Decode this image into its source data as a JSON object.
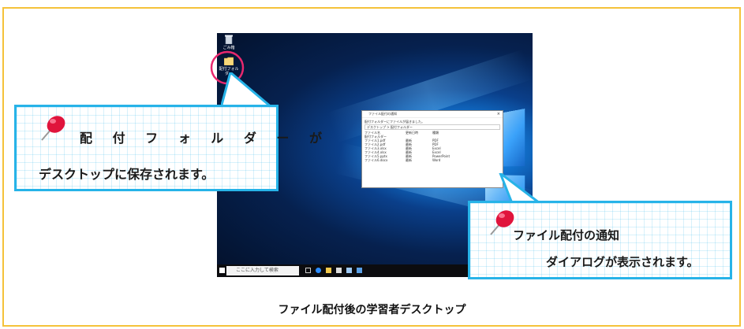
{
  "callout_left": {
    "line1": "配 付 フ ォ ル ダ ー が",
    "line2": "デスクトップに保存されます。"
  },
  "callout_right": {
    "line1": "ファイル配付の通知",
    "line2": "ダイアログが表示されます。"
  },
  "caption": "ファイル配付後の学習者デスクトップ",
  "desktop": {
    "recycle_bin_label": "ごみ箱",
    "folder_label": "配付フォルダー",
    "taskbar_search_placeholder": "ここに入力して検索"
  },
  "dialog": {
    "title": "ファイル配付の通知",
    "message": "配付フォルダーにファイルが届きました。",
    "path": "デスクトップ > 配付フォルダー",
    "columns": [
      "ファイル名",
      "更新日時",
      "種類"
    ],
    "folder_row": "配付フォルダー",
    "files": [
      {
        "name": "ファイル1.pdf",
        "date": "最新",
        "type": "PDF"
      },
      {
        "name": "ファイル2.pdf",
        "date": "最新",
        "type": "PDF"
      },
      {
        "name": "ファイル3.xlsx",
        "date": "最新",
        "type": "Excel"
      },
      {
        "name": "ファイル4.xlsx",
        "date": "最新",
        "type": "Excel"
      },
      {
        "name": "ファイル5.pptx",
        "date": "最新",
        "type": "PowerPoint"
      },
      {
        "name": "ファイル6.docx",
        "date": "最新",
        "type": "Word"
      }
    ]
  },
  "colors": {
    "frame": "#f5c23a",
    "callout_border": "#27b3e8",
    "highlight_circle": "#e8286e",
    "pin_red": "#e0143c"
  }
}
